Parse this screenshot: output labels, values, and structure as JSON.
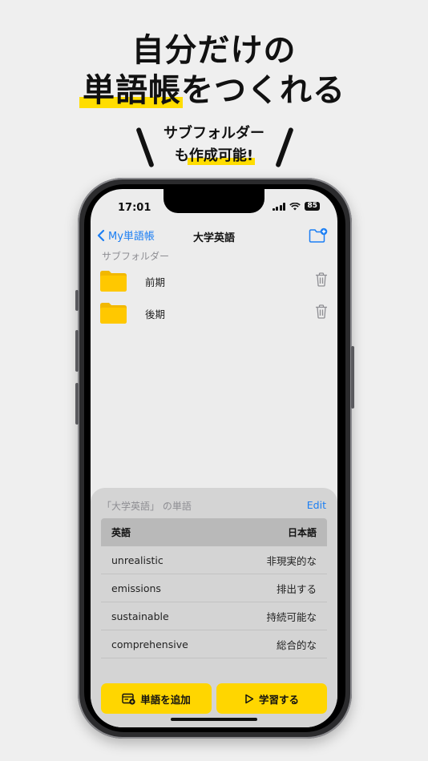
{
  "promo": {
    "headline_line1": "自分だけの",
    "headline_line2_mark": "単語帳",
    "headline_line2_rest": "をつくれる",
    "sub_line1": "サブフォルダー",
    "sub_line2_pre": "も",
    "sub_line2_mark": "作成可能!"
  },
  "status": {
    "time": "17:01",
    "battery": "85"
  },
  "nav": {
    "back_label": "My単語帳",
    "title": "大学英語"
  },
  "subfolders": {
    "section_label": "サブフォルダー",
    "items": [
      {
        "name": "前期"
      },
      {
        "name": "後期"
      }
    ]
  },
  "sheet": {
    "title": "「大学英語」 の単語",
    "edit_label": "Edit",
    "columns": {
      "left": "英語",
      "right": "日本語"
    },
    "rows": [
      {
        "en": "unrealistic",
        "ja": "非現実的な"
      },
      {
        "en": "emissions",
        "ja": "排出する"
      },
      {
        "en": "sustainable",
        "ja": "持続可能な"
      },
      {
        "en": "comprehensive",
        "ja": "総合的な"
      }
    ],
    "add_label": "単語を追加",
    "study_label": "学習する"
  },
  "colors": {
    "accent": "#ffd600",
    "link": "#1b7ef3",
    "folder": "#ffc400"
  }
}
